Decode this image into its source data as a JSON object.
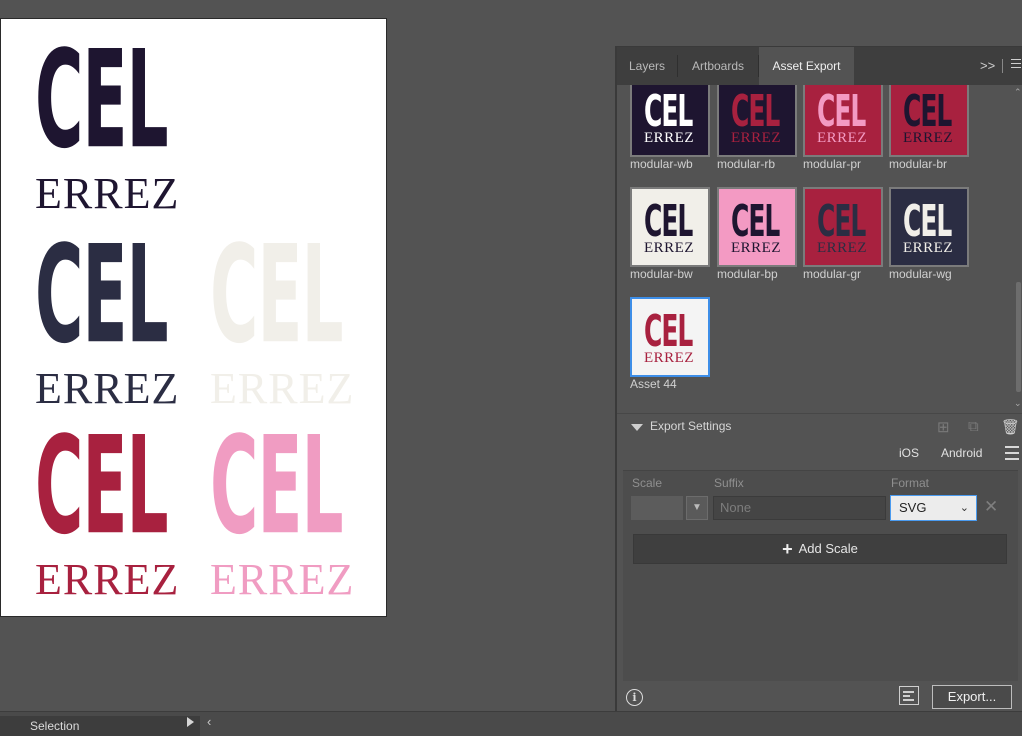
{
  "artboard": {
    "logos": [
      {
        "cel": "CEL",
        "errez": "ERREZ",
        "color": "#1e1530"
      },
      {
        "cel": "CEL",
        "errez": "ERREZ",
        "color": "#2b2d43"
      },
      {
        "cel": "CEL",
        "errez": "ERREZ",
        "color": "#f1efe9"
      },
      {
        "cel": "CEL",
        "errez": "ERREZ",
        "color": "#a8213f"
      },
      {
        "cel": "CEL",
        "errez": "ERREZ",
        "color": "#f09cc2"
      }
    ]
  },
  "panel": {
    "tabs": [
      {
        "label": "Layers",
        "active": false
      },
      {
        "label": "Artboards",
        "active": false
      },
      {
        "label": "Asset Export",
        "active": true
      }
    ],
    "more_icon": "double-chevron-right-icon",
    "assets": [
      {
        "name": "modular-wb",
        "cel": "CEL",
        "errez": "ERREZ",
        "bg": "#1e1530",
        "fg": "#ffffff",
        "fg2": "#ffffff",
        "selected": false
      },
      {
        "name": "modular-rb",
        "cel": "CEL",
        "errez": "ERREZ",
        "bg": "#1e1530",
        "fg": "#a8213f",
        "fg2": "#a8213f",
        "selected": false
      },
      {
        "name": "modular-pr",
        "cel": "CEL",
        "errez": "ERREZ",
        "bg": "#a8213f",
        "fg": "#f39ac3",
        "fg2": "#f39ac3",
        "selected": false
      },
      {
        "name": "modular-br",
        "cel": "CEL",
        "errez": "ERREZ",
        "bg": "#a8213f",
        "fg": "#1e1530",
        "fg2": "#1e1530",
        "selected": false
      },
      {
        "name": "modular-bw",
        "cel": "CEL",
        "errez": "ERREZ",
        "bg": "#f1efe9",
        "fg": "#1e1530",
        "fg2": "#1e1530",
        "selected": false
      },
      {
        "name": "modular-bp",
        "cel": "CEL",
        "errez": "ERREZ",
        "bg": "#f39ac3",
        "fg": "#1e1530",
        "fg2": "#1e1530",
        "selected": false
      },
      {
        "name": "modular-gr",
        "cel": "CEL",
        "errez": "ERREZ",
        "bg": "#a8213f",
        "fg": "#2b2d43",
        "fg2": "#2b2d43",
        "selected": false
      },
      {
        "name": "modular-wg",
        "cel": "CEL",
        "errez": "ERREZ",
        "bg": "#2b2d43",
        "fg": "#f1efe9",
        "fg2": "#f1efe9",
        "selected": false
      },
      {
        "name": "Asset 44",
        "cel": "CEL",
        "errez": "ERREZ",
        "bg": "#f4f4f4",
        "fg": "#a8213f",
        "fg2": "#a8213f",
        "selected": true
      }
    ],
    "export_settings": {
      "title": "Export Settings",
      "platforms": [
        "iOS",
        "Android"
      ],
      "columns": {
        "scale": "Scale",
        "suffix": "Suffix",
        "format": "Format"
      },
      "suffix_placeholder": "None",
      "format_value": "SVG",
      "add_scale_label": "Add Scale"
    },
    "export_button": "Export..."
  },
  "statusbar": {
    "tool": "Selection"
  }
}
